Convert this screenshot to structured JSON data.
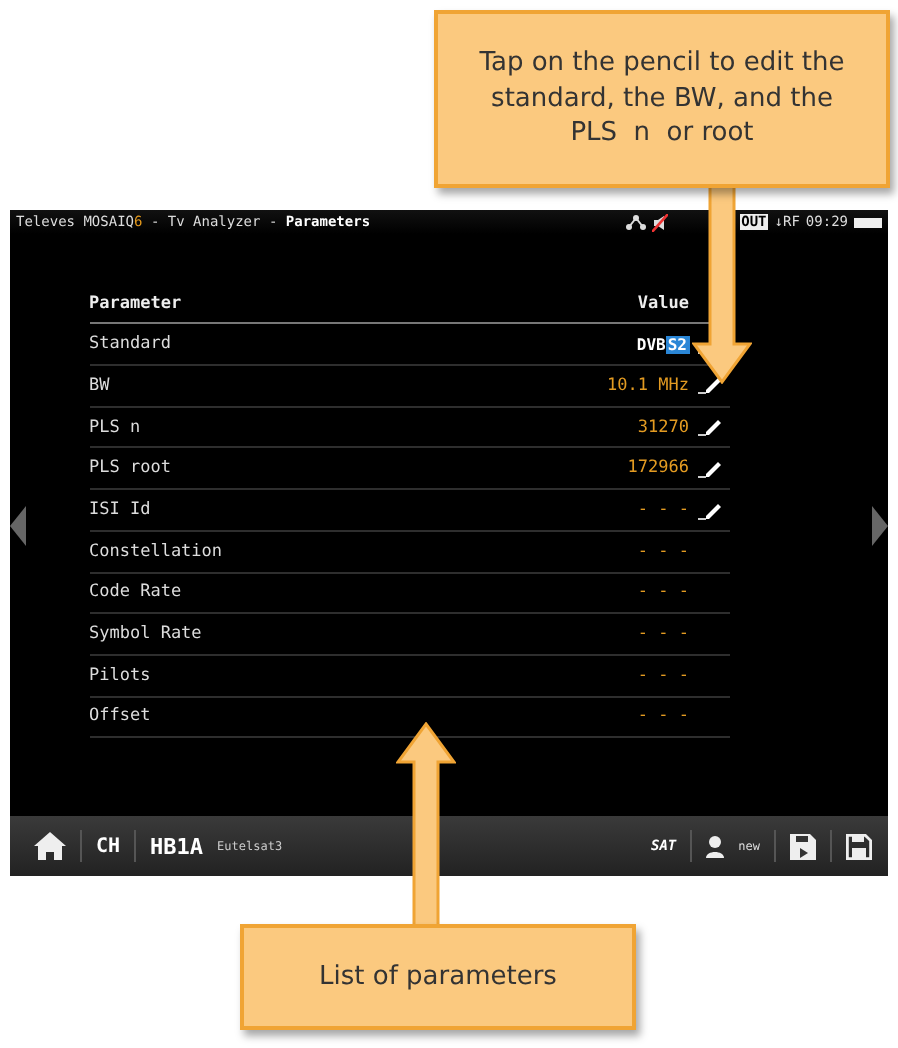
{
  "top_callout": {
    "text": "Tap on the pencil to edit the standard, the BW, and the PLS  n  or root"
  },
  "bottom_callout": {
    "text": "List of parameters"
  },
  "title_bar": {
    "brand": "Televes MOSAIQ",
    "brand_mark": "6",
    "separator_1": "-",
    "app": "Tv Analyzer",
    "separator_2": "-",
    "page": "Parameters",
    "output_label": "OUT",
    "input_label": "↓RF",
    "time": "09:29"
  },
  "table": {
    "columns": [
      "Parameter",
      "Value"
    ],
    "rows": [
      {
        "name": "Standard",
        "kind": "logo",
        "value": "DVB",
        "badge": "S2",
        "editable": true
      },
      {
        "name": "BW",
        "kind": "text",
        "value": "10.1 MHz",
        "editable": true
      },
      {
        "name": "PLS n",
        "kind": "text",
        "value": "31270",
        "editable": true
      },
      {
        "name": "PLS root",
        "kind": "text",
        "value": "172966",
        "editable": true
      },
      {
        "name": "ISI Id",
        "kind": "text",
        "value": "- - -",
        "editable": true
      },
      {
        "name": "Constellation",
        "kind": "text",
        "value": "- - -",
        "editable": false
      },
      {
        "name": "Code Rate",
        "kind": "text",
        "value": "- - -",
        "editable": false
      },
      {
        "name": "Symbol Rate",
        "kind": "text",
        "value": "- - -",
        "editable": false
      },
      {
        "name": "Pilots",
        "kind": "text",
        "value": "- - -",
        "editable": false
      },
      {
        "name": "Offset",
        "kind": "text",
        "value": "- - -",
        "editable": false
      }
    ]
  },
  "bottom_bar": {
    "channel_button": "CH",
    "channel": "HB1A",
    "satellite": "Eutelsat3",
    "band_button": "SAT",
    "user": "new"
  }
}
